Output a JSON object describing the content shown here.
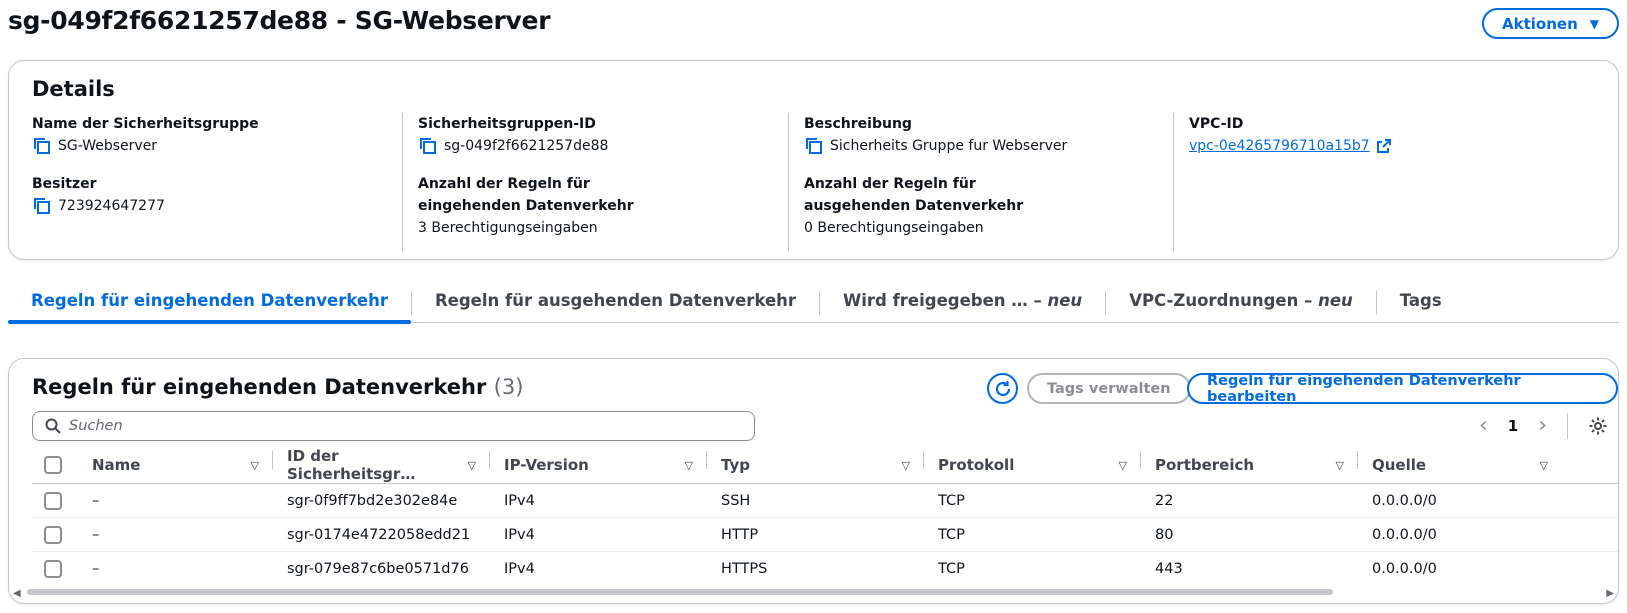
{
  "header": {
    "title": "sg-049f2f6621257de88 - SG-Webserver",
    "actions_label": "Aktionen"
  },
  "details": {
    "title": "Details",
    "name_label": "Name der Sicherheitsgruppe",
    "name_value": "SG-Webserver",
    "id_label": "Sicherheitsgruppen-ID",
    "id_value": "sg-049f2f6621257de88",
    "desc_label": "Beschreibung",
    "desc_value": "Sicherheits Gruppe fur Webserver",
    "vpc_label": "VPC-ID",
    "vpc_value": "vpc-0e4265796710a15b7",
    "owner_label": "Besitzer",
    "owner_value": "723924647277",
    "inbound_count_label": "Anzahl der Regeln für eingehenden Datenverkehr",
    "inbound_count_value": "3 Berechtigungseingaben",
    "outbound_count_label": "Anzahl der Regeln für ausgehenden Datenverkehr",
    "outbound_count_value": "0 Berechtigungseingaben"
  },
  "tabs": [
    {
      "label": "Regeln für eingehenden Datenverkehr",
      "suffix": "",
      "active": true
    },
    {
      "label": "Regeln für ausgehenden Datenverkehr",
      "suffix": "",
      "active": false
    },
    {
      "label": "Wird freigegeben … – ",
      "suffix": "neu",
      "active": false
    },
    {
      "label": "VPC-Zuordnungen – ",
      "suffix": "neu",
      "active": false
    },
    {
      "label": "Tags",
      "suffix": "",
      "active": false
    }
  ],
  "rules": {
    "title": "Regeln für eingehenden Datenverkehr",
    "count": "(3)",
    "manage_tags_label": "Tags verwalten",
    "edit_rules_label": "Regeln für eingehenden Datenverkehr bearbeiten",
    "search_placeholder": "Suchen",
    "page_number": "1",
    "columns": [
      "Name",
      "ID der Sicherheitsgr…",
      "IP-Version",
      "Typ",
      "Protokoll",
      "Portbereich",
      "Quelle"
    ],
    "rows": [
      {
        "name": "–",
        "id": "sgr-0f9ff7bd2e302e84e",
        "ip": "IPv4",
        "type": "SSH",
        "protocol": "TCP",
        "port": "22",
        "source": "0.0.0.0/0"
      },
      {
        "name": "–",
        "id": "sgr-0174e4722058edd21",
        "ip": "IPv4",
        "type": "HTTP",
        "protocol": "TCP",
        "port": "80",
        "source": "0.0.0.0/0"
      },
      {
        "name": "–",
        "id": "sgr-079e87c6be0571d76",
        "ip": "IPv4",
        "type": "HTTPS",
        "protocol": "TCP",
        "port": "443",
        "source": "0.0.0.0/0"
      }
    ]
  },
  "colors": {
    "accent": "#006ce0",
    "text": "#0f141a",
    "border": "#c6c6cd",
    "muted": "#656871"
  },
  "icons": {
    "copy": "copy-icon",
    "external": "external-link-icon",
    "refresh": "refresh-icon",
    "search": "search-icon",
    "settings": "gear-icon",
    "sort": "sort-caret-icon"
  }
}
